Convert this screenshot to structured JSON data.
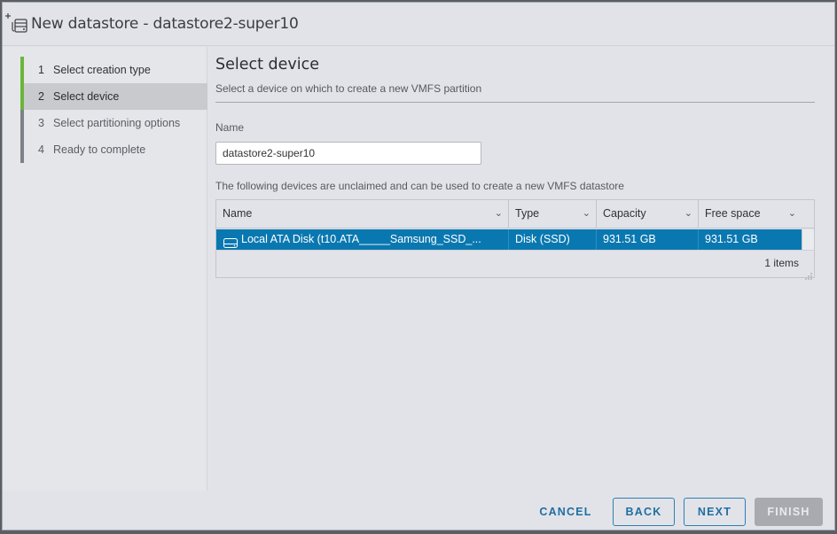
{
  "dialog": {
    "title": "New datastore - datastore2-super10"
  },
  "steps": [
    {
      "num": "1",
      "label": "Select creation type"
    },
    {
      "num": "2",
      "label": "Select device"
    },
    {
      "num": "3",
      "label": "Select partitioning options"
    },
    {
      "num": "4",
      "label": "Ready to complete"
    }
  ],
  "content": {
    "title": "Select device",
    "subtitle": "Select a device on which to create a new VMFS partition",
    "name_label": "Name",
    "name_value": "datastore2-super10",
    "grid_description": "The following devices are unclaimed and can be used to create a new VMFS datastore"
  },
  "grid": {
    "columns": [
      "Name",
      "Type",
      "Capacity",
      "Free space"
    ],
    "rows": [
      {
        "name": "Local ATA Disk (t10.ATA_____Samsung_SSD_...",
        "type": "Disk (SSD)",
        "capacity": "931.51 GB",
        "free_space": "931.51 GB"
      }
    ],
    "footer": "1 items"
  },
  "buttons": {
    "cancel": "CANCEL",
    "back": "BACK",
    "next": "NEXT",
    "finish": "FINISH"
  },
  "colors": {
    "accent": "#0a78b0",
    "step_done": "#6bb53a",
    "link": "#1d6fa3"
  },
  "icons": {
    "title": "new-datastore-icon",
    "row": "disk-icon",
    "column_menu": "chevron-down-icon"
  }
}
